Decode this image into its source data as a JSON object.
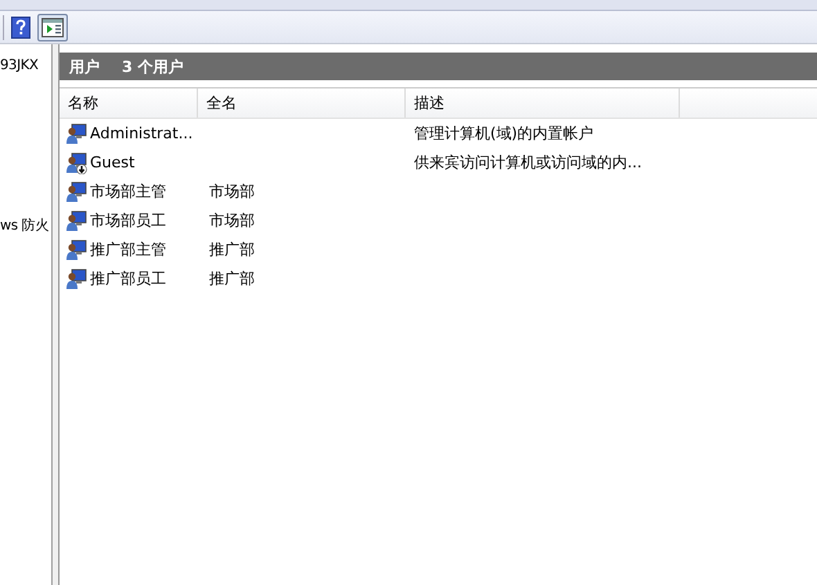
{
  "left_pane": {
    "items": [
      "93JKX",
      "ws 防火"
    ]
  },
  "panel": {
    "title": "用户",
    "count": "3 个用户"
  },
  "table": {
    "columns": [
      "名称",
      "全名",
      "描述"
    ],
    "rows": [
      {
        "name": "Administrat...",
        "full_name": "",
        "description": "管理计算机(域)的内置帐户",
        "disabled": false
      },
      {
        "name": "Guest",
        "full_name": "",
        "description": "供来宾访问计算机或访问域的内...",
        "disabled": true
      },
      {
        "name": "市场部主管",
        "full_name": "市场部",
        "description": "",
        "disabled": false
      },
      {
        "name": "市场部员工",
        "full_name": "市场部",
        "description": "",
        "disabled": false
      },
      {
        "name": "推广部主管",
        "full_name": "推广部",
        "description": "",
        "disabled": false
      },
      {
        "name": "推广部员工",
        "full_name": "推广部",
        "description": "",
        "disabled": false
      }
    ]
  }
}
